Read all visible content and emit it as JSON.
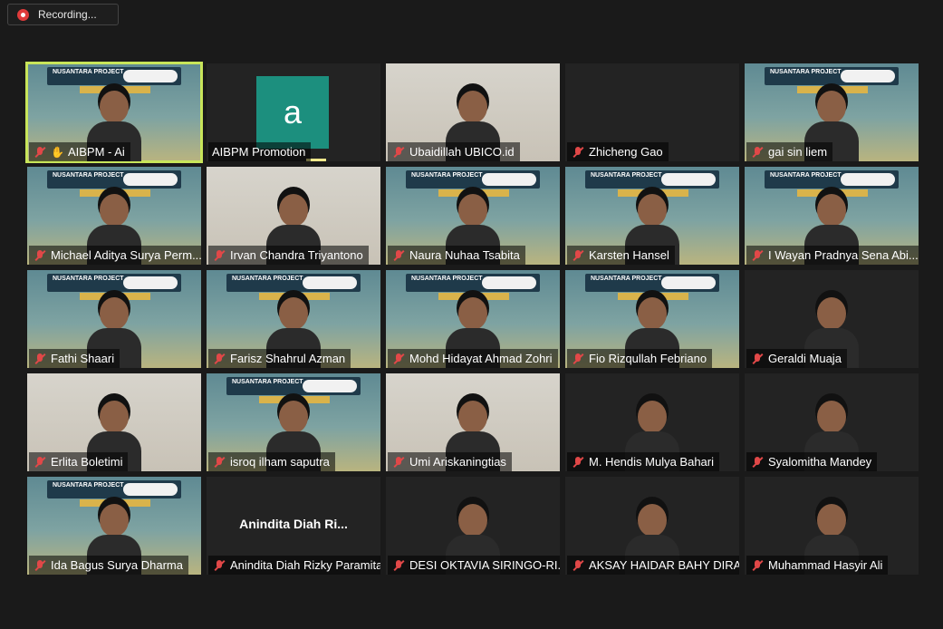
{
  "recording": {
    "label": "Recording..."
  },
  "tiles": [
    {
      "name": "AIBPM - Ai",
      "style": "banner",
      "active": true,
      "raised_hand": true,
      "muted": true
    },
    {
      "name": "AIBPM Promotion",
      "style": "avatar",
      "avatar_letter": "a",
      "muted": false
    },
    {
      "name": "Ubaidillah UBICO.id",
      "style": "room",
      "muted": true
    },
    {
      "name": "Zhicheng Gao",
      "style": "dark",
      "muted": true
    },
    {
      "name": "gai sin liem",
      "style": "banner",
      "muted": true
    },
    {
      "name": "Michael Aditya Surya Perm...",
      "style": "banner",
      "muted": true
    },
    {
      "name": "Irvan Chandra Triyantono",
      "style": "room",
      "muted": true
    },
    {
      "name": "Naura Nuhaa Tsabita",
      "style": "banner",
      "muted": true
    },
    {
      "name": "Karsten Hansel",
      "style": "banner",
      "muted": true
    },
    {
      "name": "I Wayan Pradnya Sena Abi...",
      "style": "banner",
      "muted": true
    },
    {
      "name": "Fathi Shaari",
      "style": "banner",
      "muted": true
    },
    {
      "name": "Farisz Shahrul Azman",
      "style": "banner",
      "muted": true
    },
    {
      "name": "Mohd Hidayat Ahmad Zohri",
      "style": "banner",
      "muted": true
    },
    {
      "name": "Fio Rizqullah Febriano",
      "style": "banner",
      "muted": true
    },
    {
      "name": "Geraldi Muaja",
      "style": "dark",
      "muted": true
    },
    {
      "name": "Erlita Boletimi",
      "style": "room",
      "muted": true
    },
    {
      "name": "isroq ilham saputra",
      "style": "banner",
      "muted": true
    },
    {
      "name": "Umi Ariskaningtias",
      "style": "room",
      "muted": true
    },
    {
      "name": "M. Hendis Mulya Bahari",
      "style": "dark",
      "muted": true
    },
    {
      "name": "Syalomitha Mandey",
      "style": "dark",
      "muted": true
    },
    {
      "name": "Ida Bagus Surya Dharma",
      "style": "banner",
      "muted": true
    },
    {
      "name": "Anindita Diah Rizky Paramita",
      "style": "nameonly",
      "big_name": "Anindita  Diah  Ri...",
      "muted": true
    },
    {
      "name": "DESI OKTAVIA SIRINGO-RI...",
      "style": "dark",
      "muted": true
    },
    {
      "name": "AKSAY HAIDAR BAHY DIRA",
      "style": "dark",
      "muted": true
    },
    {
      "name": "Muhammad Hasyir Ali",
      "style": "dark",
      "muted": true
    }
  ],
  "banner_text": "NUSANTARA PROJECT"
}
